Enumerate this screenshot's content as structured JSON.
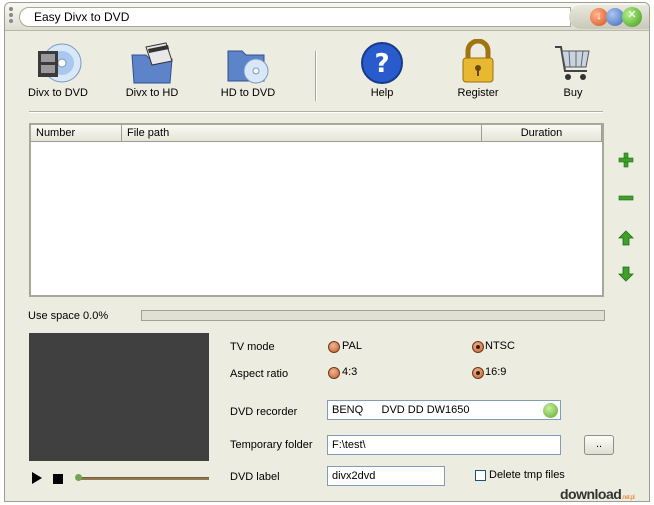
{
  "window": {
    "title": "Easy Divx to DVD"
  },
  "toolbar": {
    "divx_to_dvd": "Divx to DVD",
    "divx_to_hd": "Divx to HD",
    "hd_to_dvd": "HD to DVD",
    "help": "Help",
    "register": "Register",
    "buy": "Buy"
  },
  "file_list": {
    "columns": [
      "Number",
      "File path",
      "Duration"
    ],
    "rows": []
  },
  "usage": {
    "label": "Use space 0.0%",
    "percent": 0
  },
  "settings": {
    "tv_mode": {
      "label": "TV mode",
      "options": [
        "PAL",
        "NTSC"
      ],
      "selected": "NTSC"
    },
    "aspect_ratio": {
      "label": "Aspect ratio",
      "options": [
        "4:3",
        "16:9"
      ],
      "selected": "16:9"
    },
    "dvd_recorder": {
      "label": "DVD recorder",
      "value": "BENQ      DVD DD DW1650"
    },
    "temporary_folder": {
      "label": "Temporary folder",
      "value": "F:\\test\\",
      "browse": ".."
    },
    "dvd_label": {
      "label": "DVD label",
      "value": "divx2dvd"
    },
    "delete_tmp": {
      "label": "Delete tmp files",
      "checked": false
    }
  },
  "watermark": {
    "text": "download",
    "suffix": ".net.pl"
  }
}
